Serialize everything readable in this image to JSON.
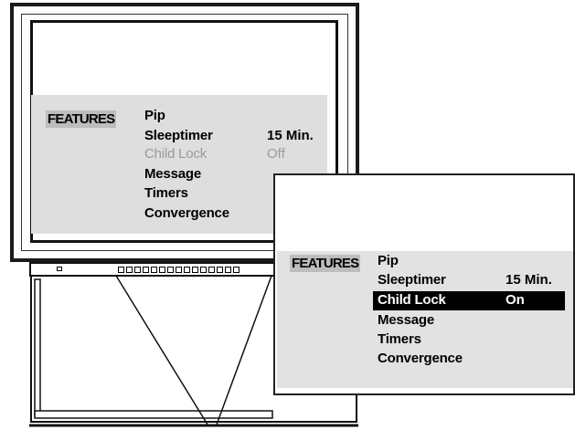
{
  "menu1": {
    "category": "FEATURES",
    "items": [
      {
        "label": "Pip",
        "value": ""
      },
      {
        "label": "Sleeptimer",
        "value": "15 Min."
      },
      {
        "label": "Child Lock",
        "value": "Off"
      },
      {
        "label": "Message",
        "value": ""
      },
      {
        "label": "Timers",
        "value": ""
      },
      {
        "label": "Convergence",
        "value": ""
      }
    ]
  },
  "menu2": {
    "category": "FEATURES",
    "items": [
      {
        "label": "Pip",
        "value": ""
      },
      {
        "label": "Sleeptimer",
        "value": "15 Min."
      },
      {
        "label": "Child Lock",
        "value": "On"
      },
      {
        "label": "Message",
        "value": ""
      },
      {
        "label": "Timers",
        "value": ""
      },
      {
        "label": "Convergence",
        "value": ""
      }
    ]
  },
  "colors": {
    "highlight": "#000000",
    "menu_bg": "#dedede",
    "category_bg": "#bdbdbd"
  }
}
